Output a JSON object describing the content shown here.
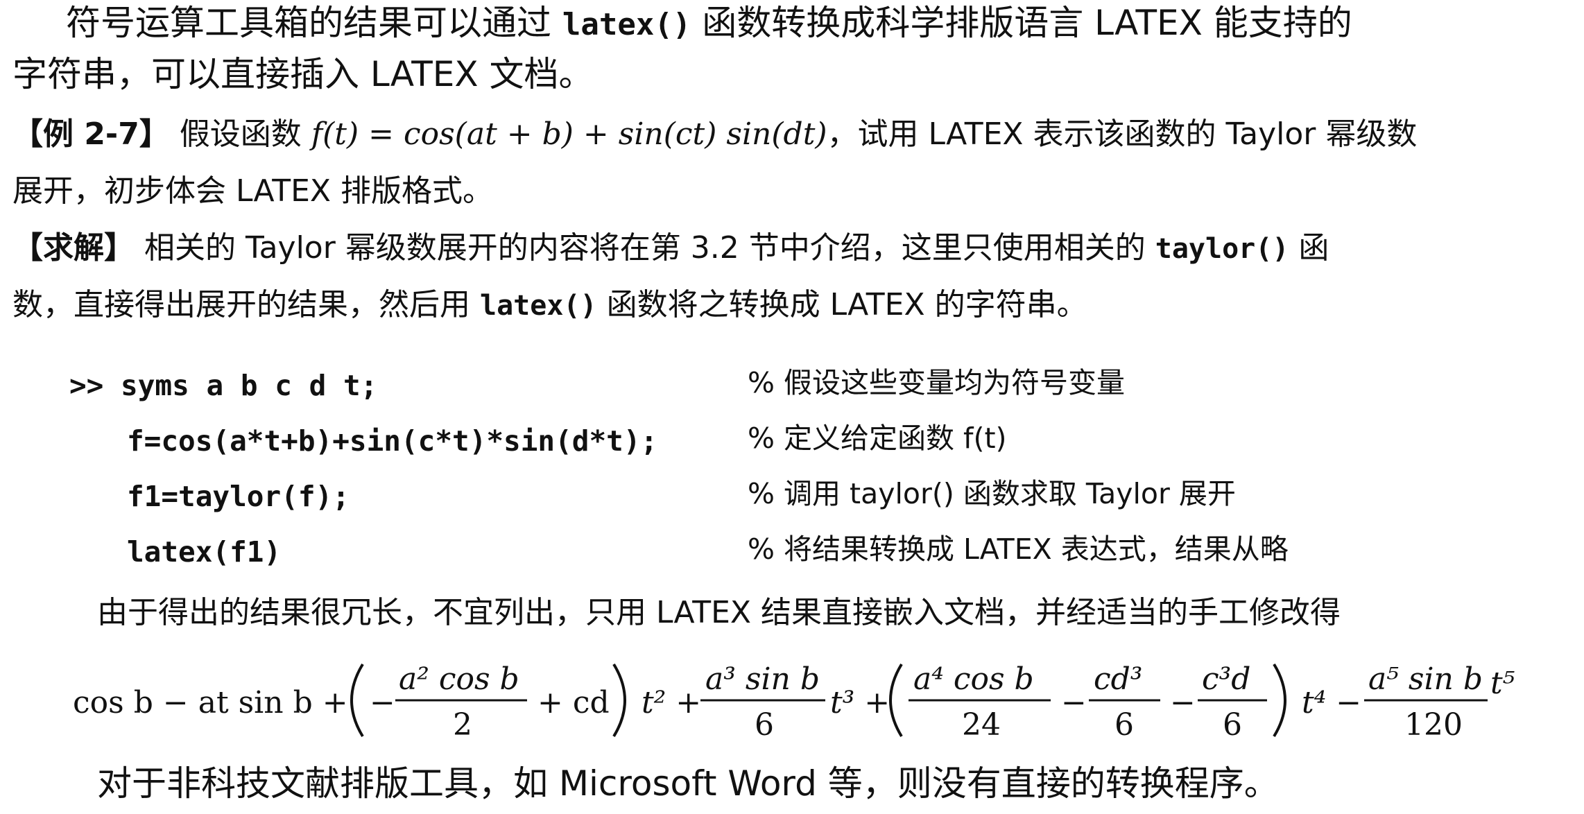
{
  "para1": {
    "l1_a": "符号运算工具箱的结果可以通过",
    "l1_code": "latex()",
    "l1_b": "函数转换成科学排版语言 LATEX 能支持的",
    "l2": "字符串，可以直接插入 LATEX 文档。"
  },
  "example": {
    "label": "【例 2-7】",
    "l1_a": "假设函数",
    "l1_f": "f(t) = cos(at + b) + sin(ct) sin(dt)",
    "l1_b": "，试用 LATEX 表示该函数的 Taylor 幂级数",
    "l2": "展开，初步体会 LATEX 排版格式。"
  },
  "solution": {
    "label": "【求解】",
    "l1_a": "相关的 Taylor 幂级数展开的内容将在第 3.2 节中介绍，这里只使用相关的",
    "l1_code": "taylor()",
    "l1_b": "函",
    "l2_a": "数，直接得出展开的结果，然后用",
    "l2_code": "latex()",
    "l2_b": "函数将之转换成 LATEX 的字符串。"
  },
  "code": [
    {
      "code": ">> syms a b c d t;",
      "comment": "% 假设这些变量均为符号变量"
    },
    {
      "code": "f=cos(a*t+b)+sin(c*t)*sin(d*t);",
      "comment": "% 定义给定函数 f(t)"
    },
    {
      "code": "f1=taylor(f);",
      "comment": "% 调用 taylor() 函数求取 Taylor 展开"
    },
    {
      "code": "latex(f1)",
      "comment": "% 将结果转换成 LATEX 表达式，结果从略"
    }
  ],
  "para3": "由于得出的结果很冗长，不宜列出，只用 LATEX 结果直接嵌入文档，并经适当的手工修改得",
  "formula": {
    "t1": "cos b − at sin b +",
    "f1_num": "a² cos b",
    "f1_den": "2",
    "f1_pre": "−",
    "f1_post": "+ cd",
    "t2": "t² +",
    "f2_num": "a³ sin b",
    "f2_den": "6",
    "t3": "t³ +",
    "f3_num": "a⁴ cos b",
    "f3_den": "24",
    "minus1": "−",
    "f4_num": "cd³",
    "f4_den": "6",
    "minus2": "−",
    "f5_num": "c³d",
    "f5_den": "6",
    "t4": "t⁴ −",
    "f6_num": "a⁵ sin b",
    "f6_den": "120",
    "t5": "t⁵"
  },
  "para4": "对于非科技文献排版工具，如 Microsoft Word 等，则没有直接的转换程序。"
}
